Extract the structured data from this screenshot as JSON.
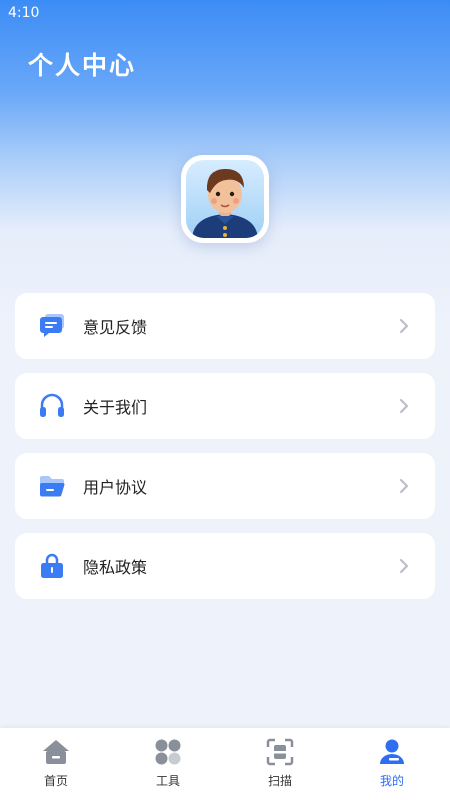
{
  "status_bar": {
    "time": "4:10"
  },
  "header": {
    "title": "个人中心"
  },
  "menu": {
    "items": [
      {
        "label": "意见反馈",
        "icon": "feedback-chat-icon"
      },
      {
        "label": "关于我们",
        "icon": "headphones-icon"
      },
      {
        "label": "用户协议",
        "icon": "folder-icon"
      },
      {
        "label": "隐私政策",
        "icon": "lock-icon"
      }
    ]
  },
  "tabbar": {
    "tabs": [
      {
        "label": "首页",
        "icon": "home-icon",
        "active": false
      },
      {
        "label": "工具",
        "icon": "tools-grid-icon",
        "active": false
      },
      {
        "label": "扫描",
        "icon": "scan-icon",
        "active": false
      },
      {
        "label": "我的",
        "icon": "profile-icon",
        "active": true
      }
    ]
  },
  "colors": {
    "accent": "#2f6df3",
    "menu_icon": "#3b7cf5",
    "tab_inactive": "#8a9099",
    "background": "#eef2fb"
  }
}
